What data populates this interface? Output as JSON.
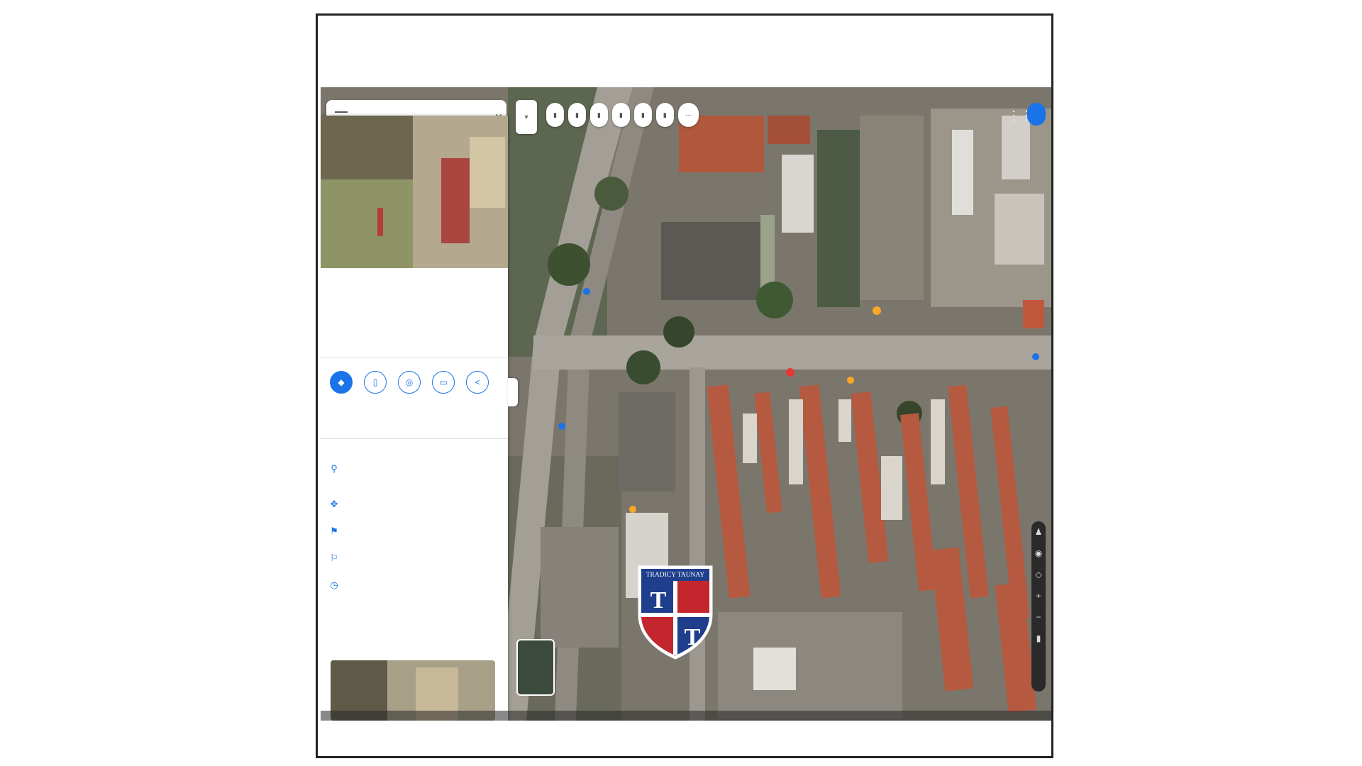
{
  "watermark": {
    "text": "TRADICY TAUNAY",
    "letter_left": "T",
    "letter_right": "T"
  },
  "search": {
    "query": ""
  },
  "chips": [],
  "panel": {
    "title": "",
    "subtitle": "",
    "actions": [
      {
        "icon": "directions-icon",
        "label": ""
      },
      {
        "icon": "save-icon",
        "label": ""
      },
      {
        "icon": "nearby-icon",
        "label": ""
      },
      {
        "icon": "send-to-phone-icon",
        "label": ""
      },
      {
        "icon": "share-icon",
        "label": ""
      }
    ],
    "info": [
      {
        "icon": "location-pin-icon",
        "text": ""
      },
      {
        "icon": "plus-code-icon",
        "text": ""
      },
      {
        "icon": "add-business-icon",
        "text": ""
      },
      {
        "icon": "add-label-icon",
        "text": ""
      },
      {
        "icon": "history-icon",
        "text": ""
      }
    ],
    "photos_label": ""
  },
  "layers_label": "",
  "colors": {
    "accent": "#1a73e8",
    "crest_blue": "#1f3e8c",
    "crest_red": "#c4262e"
  }
}
